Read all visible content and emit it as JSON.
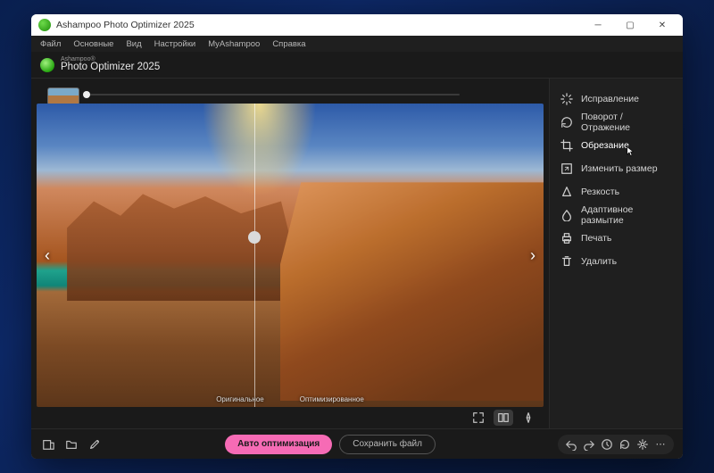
{
  "window": {
    "title": "Ashampoo Photo Optimizer 2025"
  },
  "menu": {
    "items": [
      "Файл",
      "Основные",
      "Вид",
      "Настройки",
      "MyAshampoo",
      "Справка"
    ]
  },
  "brand": {
    "sup": "Ashampoo®",
    "main": "Photo Optimizer 2025"
  },
  "compare": {
    "left_label": "Оригинальное",
    "right_label": "Оптимизированное"
  },
  "tools": {
    "items": [
      {
        "icon": "sparkle",
        "label": "Исправление"
      },
      {
        "icon": "rotate",
        "label": "Поворот / Отражение"
      },
      {
        "icon": "crop",
        "label": "Обрезание",
        "selected": true
      },
      {
        "icon": "resize",
        "label": "Изменить размер"
      },
      {
        "icon": "sharpen",
        "label": "Резкость"
      },
      {
        "icon": "blur",
        "label": "Адаптивное размытие"
      },
      {
        "icon": "print",
        "label": "Печать"
      },
      {
        "icon": "delete",
        "label": "Удалить"
      }
    ]
  },
  "footer": {
    "auto": "Авто оптимизация",
    "save": "Сохранить файл"
  }
}
